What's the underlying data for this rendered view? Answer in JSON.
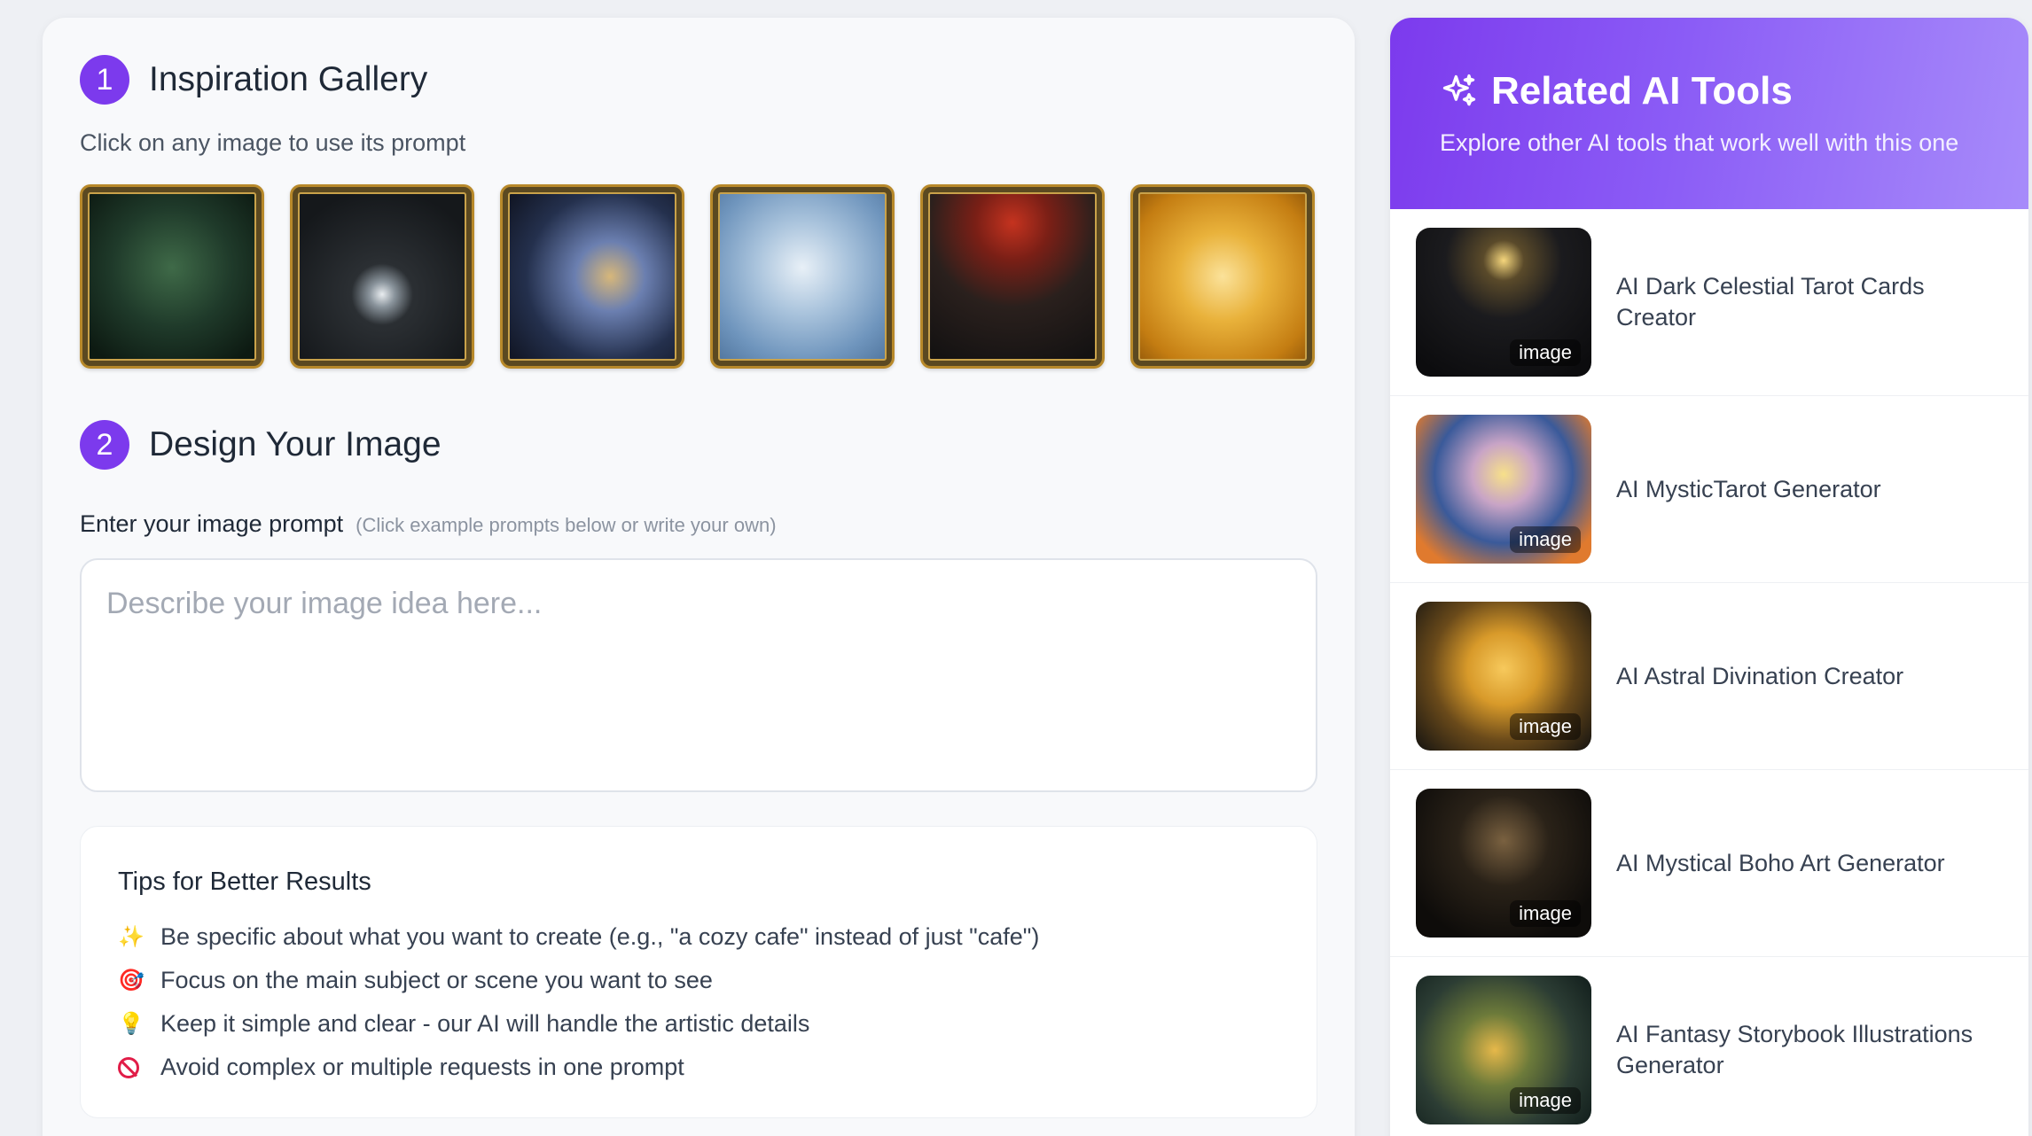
{
  "gallery": {
    "step": "1",
    "title": "Inspiration Gallery",
    "subtitle": "Click on any image to use its prompt",
    "images": [
      "forest-druid-tarot",
      "hooded-orb-tarot",
      "cosmic-wizard-tarot",
      "ice-queen-tarot",
      "red-moon-witch-tarot",
      "golden-goddess-tarot"
    ]
  },
  "design": {
    "step": "2",
    "title": "Design Your Image",
    "prompt_label": "Enter your image prompt",
    "prompt_hint": "(Click example prompts below or write your own)",
    "prompt_value": "",
    "prompt_placeholder": "Describe your image idea here..."
  },
  "tips": {
    "title": "Tips for Better Results",
    "items": [
      {
        "icon": "✨",
        "text": "Be specific about what you want to create (e.g., \"a cozy cafe\" instead of just \"cafe\")"
      },
      {
        "icon": "🎯",
        "text": "Focus on the main subject or scene you want to see"
      },
      {
        "icon": "💡",
        "text": "Keep it simple and clear - our AI will handle the artistic details"
      },
      {
        "icon": "ban-icon",
        "text": "Avoid complex or multiple requests in one prompt"
      }
    ]
  },
  "related": {
    "title": "Related AI Tools",
    "subtitle": "Explore other AI tools that work well with this one",
    "tools": [
      {
        "name": "AI Dark Celestial Tarot Cards Creator",
        "tag": "image"
      },
      {
        "name": "AI MysticTarot Generator",
        "tag": "image"
      },
      {
        "name": "AI Astral Divination Creator",
        "tag": "image"
      },
      {
        "name": "AI Mystical Boho Art Generator",
        "tag": "image"
      },
      {
        "name": "AI Fantasy Storybook Illustrations Generator",
        "tag": "image"
      }
    ]
  },
  "colors": {
    "accent": "#7c3aed",
    "header_gradient_start": "#7c3aed",
    "header_gradient_end": "#a78bfa"
  }
}
